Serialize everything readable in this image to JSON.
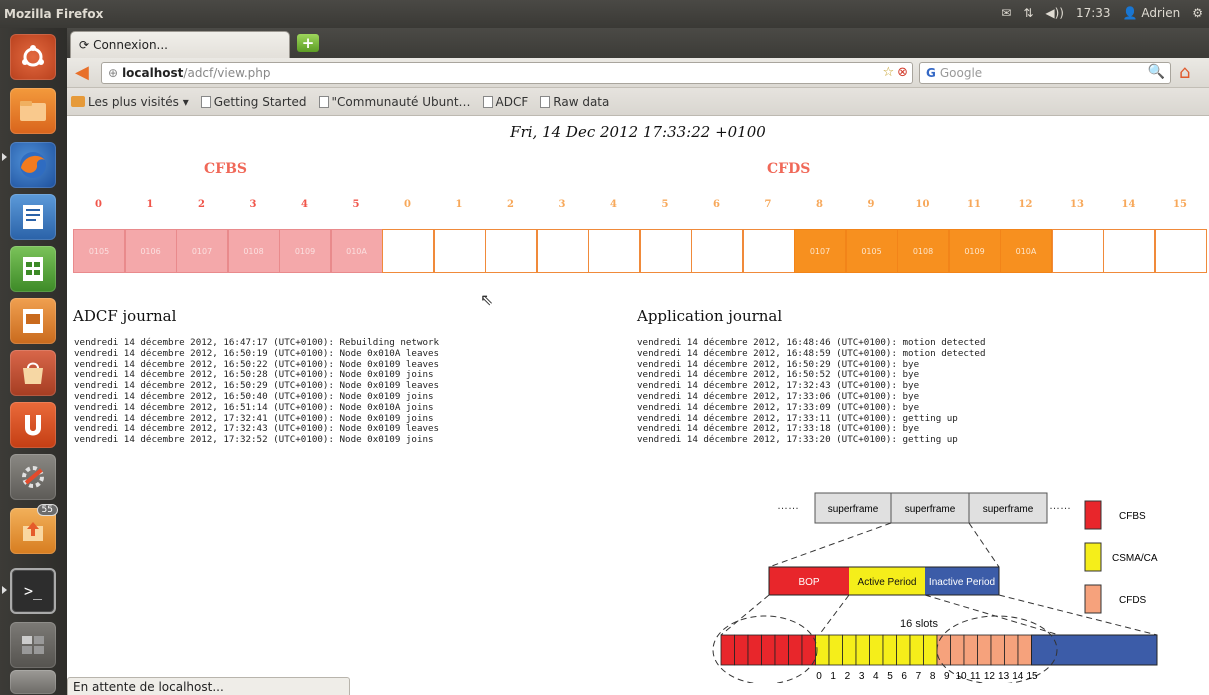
{
  "panel": {
    "app_title": "Mozilla Firefox",
    "mail": "✉",
    "network": "⇅",
    "volume": "◀))",
    "time": "17:33",
    "user": "Adrien"
  },
  "browser": {
    "tab_title": "Connexion...",
    "new_tab": "+",
    "url_host": "localhost",
    "url_path": "/adcf/view.php",
    "search_engine": "Google",
    "status": "En attente de localhost...",
    "bookmarks": [
      "Les plus visités ▾",
      "Getting Started",
      "\"Communauté Ubunt…",
      "ADCF",
      "Raw data"
    ]
  },
  "page": {
    "datetime": "Fri, 14 Dec 2012 17:33:22 +0100",
    "cfbs_label": "CFBS",
    "cfds_label": "CFDS",
    "cfbs_numbers": [
      "0",
      "1",
      "2",
      "3",
      "4",
      "5"
    ],
    "cfds_numbers": [
      "0",
      "1",
      "2",
      "3",
      "4",
      "5",
      "6",
      "7",
      "8",
      "9",
      "10",
      "11",
      "12",
      "13",
      "14",
      "15"
    ],
    "cfbs_slots": [
      "0105",
      "0106",
      "0107",
      "0108",
      "0109",
      "010A"
    ],
    "cfds_slots": [
      "",
      "",
      "",
      "",
      "",
      "",
      "",
      "",
      "0107",
      "0105",
      "0108",
      "0109",
      "010A",
      "",
      "",
      ""
    ],
    "adcf_title": "ADCF journal",
    "adcf_journal": [
      "vendredi 14 décembre 2012, 16:47:17 (UTC+0100): Rebuilding network",
      "vendredi 14 décembre 2012, 16:50:19 (UTC+0100): Node 0x010A leaves",
      "vendredi 14 décembre 2012, 16:50:22 (UTC+0100): Node 0x0109 leaves",
      "vendredi 14 décembre 2012, 16:50:28 (UTC+0100): Node 0x0109 joins",
      "vendredi 14 décembre 2012, 16:50:29 (UTC+0100): Node 0x0109 leaves",
      "vendredi 14 décembre 2012, 16:50:40 (UTC+0100): Node 0x0109 joins",
      "vendredi 14 décembre 2012, 16:51:14 (UTC+0100): Node 0x010A joins",
      "vendredi 14 décembre 2012, 17:32:41 (UTC+0100): Node 0x0109 joins",
      "vendredi 14 décembre 2012, 17:32:43 (UTC+0100): Node 0x0109 leaves",
      "vendredi 14 décembre 2012, 17:32:52 (UTC+0100): Node 0x0109 joins"
    ],
    "app_title": "Application journal",
    "app_journal": [
      "vendredi 14 décembre 2012, 16:48:46 (UTC+0100): motion detected",
      "vendredi 14 décembre 2012, 16:48:59 (UTC+0100): motion detected",
      "vendredi 14 décembre 2012, 16:50:29 (UTC+0100): bye",
      "vendredi 14 décembre 2012, 16:50:52 (UTC+0100): bye",
      "vendredi 14 décembre 2012, 17:32:43 (UTC+0100): bye",
      "vendredi 14 décembre 2012, 17:33:06 (UTC+0100): bye",
      "vendredi 14 décembre 2012, 17:33:09 (UTC+0100): bye",
      "vendredi 14 décembre 2012, 17:33:11 (UTC+0100): getting up",
      "vendredi 14 décembre 2012, 17:33:18 (UTC+0100): bye",
      "vendredi 14 décembre 2012, 17:33:20 (UTC+0100): getting up"
    ]
  },
  "diagram": {
    "superframes": [
      "superframe",
      "superframe",
      "superframe"
    ],
    "dots": "……",
    "bop": "BOP",
    "active": "Active Period",
    "inactive": "Inactive Period",
    "slots_label": "16 slots",
    "slot_numbers": [
      "0",
      "1",
      "2",
      "3",
      "4",
      "5",
      "6",
      "7",
      "8",
      "9",
      "10",
      "11",
      "12",
      "13",
      "14",
      "15"
    ],
    "legend": [
      "CFBS",
      "CSMA/CA",
      "CFDS"
    ],
    "colors": {
      "cfbs": "#e8262b",
      "csma": "#f5ee1a",
      "cfds": "#f6a27c",
      "inactive": "#3c5ca8"
    }
  },
  "launcher": {
    "badge": "55",
    "icons": [
      "ubuntu-icon",
      "files-icon",
      "firefox-icon",
      "writer-icon",
      "calc-icon",
      "impress-icon",
      "software-center-icon",
      "ubuntu-one-icon",
      "settings-icon",
      "updates-icon",
      "terminal-icon",
      "workspaces-icon",
      "trash-icon"
    ]
  },
  "glyphs": {
    "cursor": "⇖",
    "search_go": "🔍",
    "home": "⌂",
    "back": "◀",
    "star": "☆",
    "stop": "⊗",
    "globe": "⊕",
    "engine": "G",
    "reload": "⟳",
    "gear": "⚙",
    "person": "👤"
  }
}
